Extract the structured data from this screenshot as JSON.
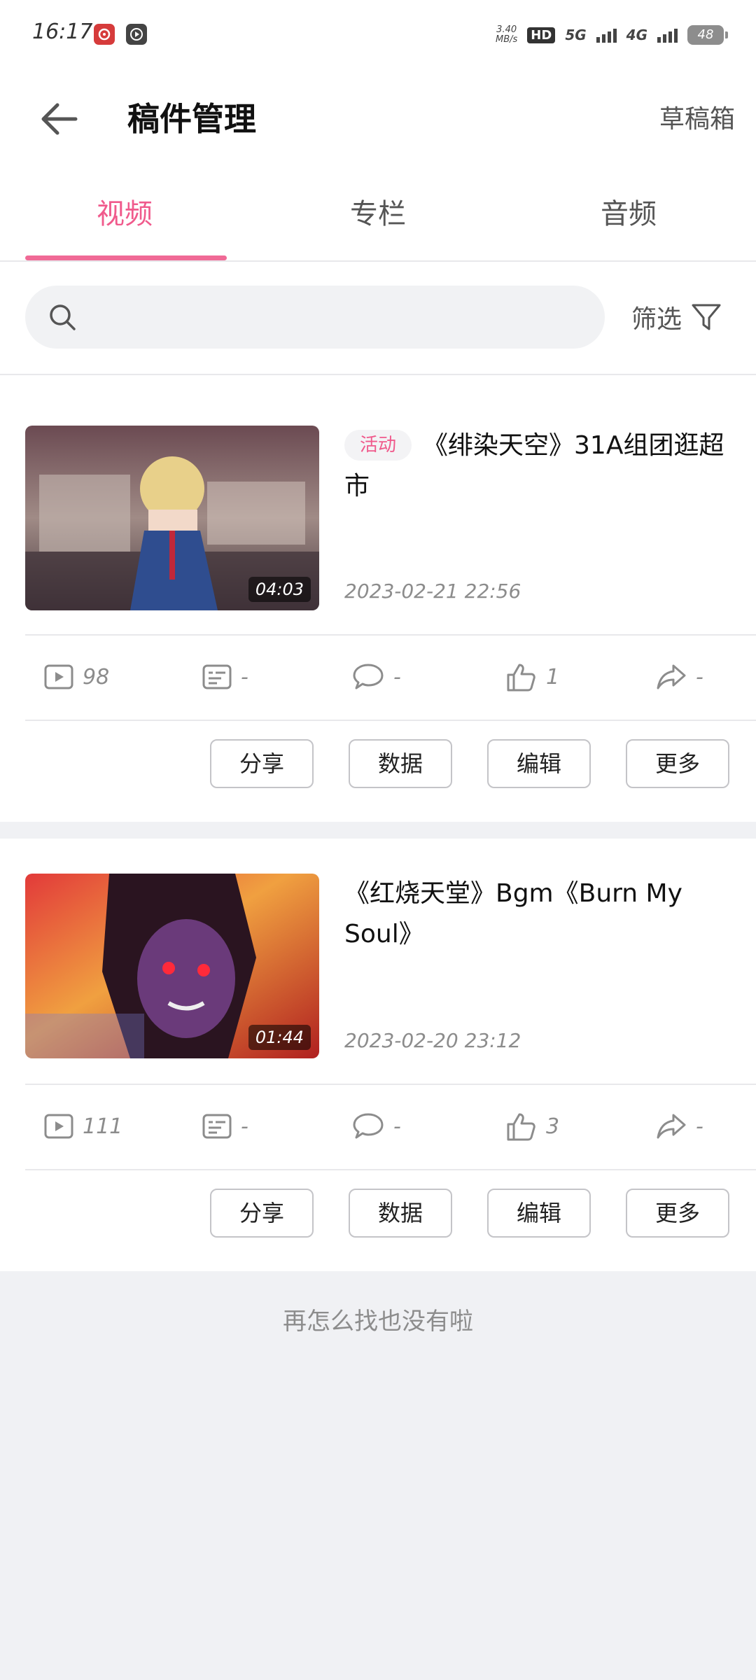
{
  "status_bar": {
    "time": "16:17",
    "net_speed_value": "3.40",
    "net_speed_unit": "MB/s",
    "hd_label": "HD",
    "network_5g": "5G",
    "network_4g": "4G",
    "battery": "48"
  },
  "header": {
    "title": "稿件管理",
    "drafts_label": "草稿箱"
  },
  "tabs": [
    {
      "label": "视频",
      "active": true
    },
    {
      "label": "专栏",
      "active": false
    },
    {
      "label": "音频",
      "active": false
    }
  ],
  "search": {
    "placeholder": "",
    "value": "",
    "filter_label": "筛选"
  },
  "videos": [
    {
      "badge": "活动",
      "title": "《绯染天空》31A组团逛超市",
      "date": "2023-02-21 22:56",
      "duration": "04:03",
      "stats": {
        "plays": "98",
        "danmaku": "-",
        "comments": "-",
        "likes": "1",
        "shares": "-"
      },
      "actions": [
        "分享",
        "数据",
        "编辑",
        "更多"
      ]
    },
    {
      "badge": "",
      "title": "《红烧天堂》Bgm《Burn My Soul》",
      "date": "2023-02-20 23:12",
      "duration": "01:44",
      "stats": {
        "plays": "111",
        "danmaku": "-",
        "comments": "-",
        "likes": "3",
        "shares": "-"
      },
      "actions": [
        "分享",
        "数据",
        "编辑",
        "更多"
      ]
    }
  ],
  "end_text": "再怎么找也没有啦",
  "colors": {
    "accent": "#f05a8c",
    "background": "#f0f1f4",
    "muted_text": "#8c8c8c"
  }
}
